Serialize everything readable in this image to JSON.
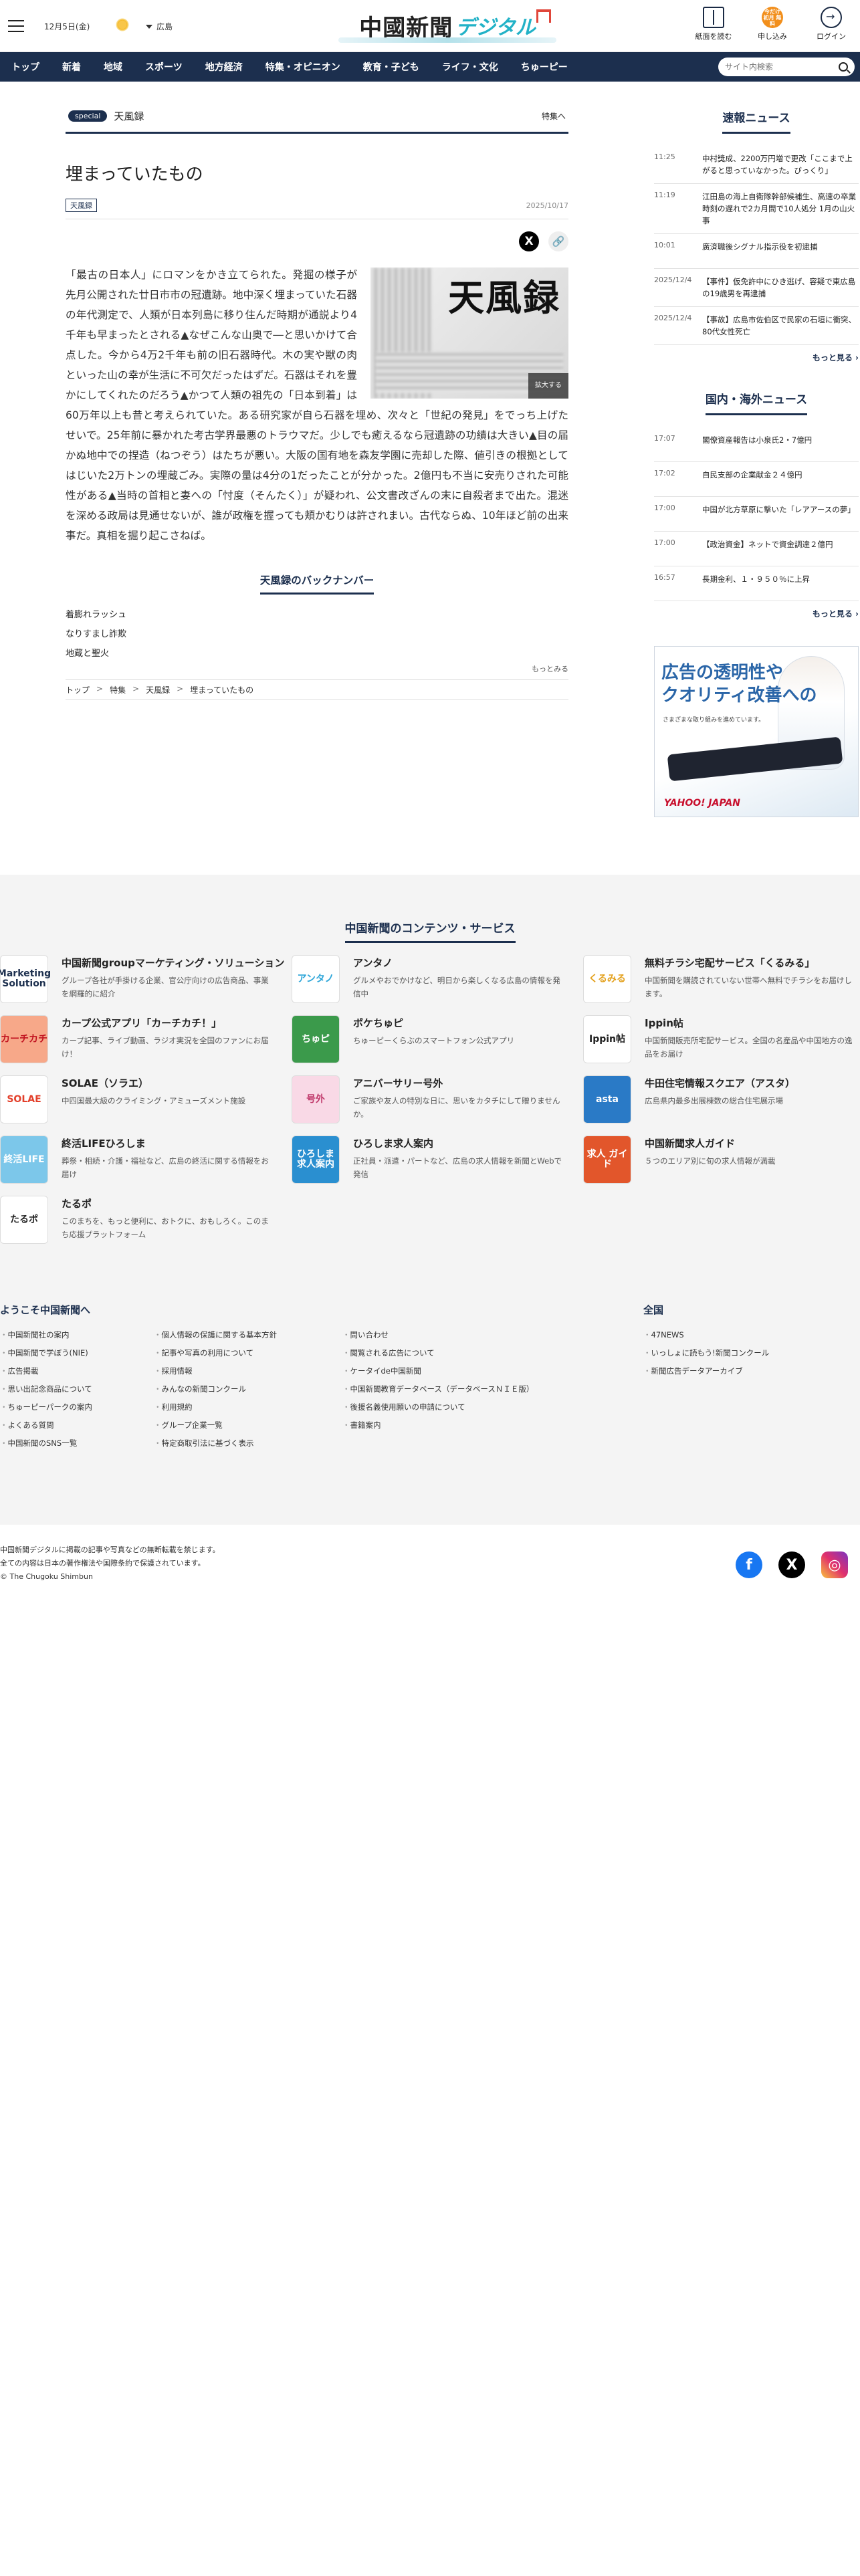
{
  "header": {
    "date": "12月5日(金)",
    "region": "広島",
    "logo_main": "中國新聞",
    "logo_sub": "デジタル",
    "icons": [
      {
        "name": "paper-icon",
        "label": "紙面を読む"
      },
      {
        "name": "apply-icon",
        "label": "申し込み",
        "badge": "今だけ 初月 無料"
      },
      {
        "name": "login-icon",
        "label": "ログイン"
      }
    ]
  },
  "nav": {
    "items": [
      "トップ",
      "新着",
      "地域",
      "スポーツ",
      "地方経済",
      "特集・オピニオン",
      "教育・子ども",
      "ライフ・文化",
      "ちゅーピー"
    ],
    "search_placeholder": "サイト内検索"
  },
  "special": {
    "pill": "special",
    "name": "天風録",
    "link": "特集へ"
  },
  "article": {
    "title": "埋まっていたもの",
    "tag": "天風録",
    "date": "2025/10/17",
    "photo_text": "天風録",
    "enlarge": "拡大する",
    "body": "「最古の日本人」にロマンをかき立てられた。発掘の様子が先月公開された廿日市市の冠遺跡。地中深く埋まっていた石器の年代測定で、人類が日本列島に移り住んだ時期が通説より4千年も早まったとされる▲なぜこんな山奥で―と思いかけて合点した。今から4万2千年も前の旧石器時代。木の実や獣の肉といった山の幸が生活に不可欠だったはずだ。石器はそれを豊かにしてくれたのだろう▲かつて人類の祖先の「日本到着」は60万年以上も昔と考えられていた。ある研究家が自ら石器を埋め、次々と「世紀の発見」をでっち上げたせいで。25年前に暴かれた考古学界最悪のトラウマだ。少しでも癒えるなら冠遺跡の功績は大きい▲目の届かぬ地中での捏造（ねつぞう）はたちが悪い。大阪の国有地を森友学園に売却した際、値引きの根拠としてはじいた2万トンの埋蔵ごみ。実際の量は4分の1だったことが分かった。2億円も不当に安売りされた可能性がある▲当時の首相と妻への「忖度（そんたく）」が疑われ、公文書改ざんの末に自殺者まで出た。混迷を深める政局は見通せないが、誰が政権を握っても頬かむりは許されまい。古代ならぬ、10年ほど前の出来事だ。真相を掘り起こさねば。"
  },
  "backnumbers": {
    "title": "天風録のバックナンバー",
    "items": [
      "着膨れラッシュ",
      "なりすまし詐欺",
      "地蔵と聖火"
    ],
    "more": "もっとみる"
  },
  "breadcrumb": [
    "トップ",
    "特集",
    "天風録",
    "埋まっていたもの"
  ],
  "sidebar": {
    "breaking": {
      "title": "速報ニュース",
      "items": [
        {
          "time": "11:25",
          "headline": "中村獎成、2200万円増で更改「ここまで上がると思っていなかった。びっくり」"
        },
        {
          "time": "11:19",
          "headline": "江田島の海上自衛隊幹部候補生、高速の卒業時刻の遅れで2カ月間で10人処分 1月の山火事"
        },
        {
          "time": "10:01",
          "headline": "廣済職後シグナル指示役を初逮捕"
        },
        {
          "time": "2025/12/4",
          "headline": "【事件】仮免許中にひき逃げ、容疑で東広島の19歳男を再逮捕"
        },
        {
          "time": "2025/12/4",
          "headline": "【事故】広島市佐伯区で民家の石垣に衝突、80代女性死亡"
        }
      ],
      "more": "もっと見る"
    },
    "national": {
      "title": "国内・海外ニュース",
      "items": [
        {
          "time": "17:07",
          "headline": "閣僚資産報告は小泉氏2・7億円"
        },
        {
          "time": "17:02",
          "headline": "自民支部の企業献金２４億円"
        },
        {
          "time": "17:00",
          "headline": "中国が北方草原に撃いた「レアアースの夢」"
        },
        {
          "time": "17:00",
          "headline": "【政治資金】ネットで資金調達２億円"
        },
        {
          "time": "16:57",
          "headline": "長期金利、１・９５０％に上昇"
        }
      ],
      "more": "もっと見る"
    },
    "ad": {
      "line1": "広告の透明性や",
      "line2": "クオリティ改善への",
      "sub": "さまざまな取り組みを進めています。",
      "logo": "YAHOO! JAPAN"
    }
  },
  "footer": {
    "services_title": "中国新聞のコンテンツ・サービス",
    "services": [
      {
        "name": "中国新聞groupマーケティング・ソリューション",
        "desc": "グループ各社が手掛ける企業、官公庁向けの広告商品、事業を網羅的に紹介",
        "logo": "Marketing Solution",
        "color": "#ffffff",
        "fg": "#1c2f4e"
      },
      {
        "name": "アンタノ",
        "desc": "グルメやおでかけなど、明日から楽しくなる広島の情報を発信中",
        "logo": "アンタノ",
        "color": "#ffffff",
        "fg": "#2aa4d8"
      },
      {
        "name": "無料チラシ宅配サービス「くるみる」",
        "desc": "中国新聞を購読されていない世帯へ無料でチラシをお届けします。",
        "logo": "くるみる",
        "color": "#ffffff",
        "fg": "#e3a01b"
      },
      {
        "name": "カープ公式アプリ「カーチカチ！」",
        "desc": "カープ記事、ライブ動画、ラジオ実況を全国のファンにお届け！",
        "logo": "カーチカチ",
        "color": "#f7a889",
        "fg": "#c1121f"
      },
      {
        "name": "ポケちゅピ",
        "desc": "ちゅーピーくらぶのスマートフォン公式アプリ",
        "logo": "ちゅピ",
        "color": "#3b9a4b",
        "fg": "#ffffff"
      },
      {
        "name": "Ippin帖",
        "desc": "中国新聞販売所宅配サービス。全国の名産品や中国地方の逸品をお届け",
        "logo": "Ippin帖",
        "color": "#ffffff",
        "fg": "#222222"
      },
      {
        "name": "SOLAE（ソラエ）",
        "desc": "中四国最大級のクライミング・アミューズメント施設",
        "logo": "SOLAE",
        "color": "#ffffff",
        "fg": "#e3402b"
      },
      {
        "name": "アニバーサリー号外",
        "desc": "ご家族や友人の特別な日に、思いをカタチにして贈りませんか。",
        "logo": "号外",
        "color": "#f9d9e6",
        "fg": "#c0396b"
      },
      {
        "name": "牛田住宅情報スクエア（アスタ）",
        "desc": "広島県内最多出展棟数の総合住宅展示場",
        "logo": "asta",
        "color": "#2a7ac6",
        "fg": "#ffffff"
      },
      {
        "name": "終活LIFEひろしま",
        "desc": "葬祭・相続・介護・福祉など、広島の終活に関する情報をお届け",
        "logo": "終活LIFE",
        "color": "#7cc7ea",
        "fg": "#ffffff"
      },
      {
        "name": "ひろしま求人案内",
        "desc": "正社員・派遣・パートなど、広島の求人情報を新聞とWebで発信",
        "logo": "ひろしま 求人案内",
        "color": "#2a8fd0",
        "fg": "#ffffff"
      },
      {
        "name": "中国新聞求人ガイド",
        "desc": "５つのエリア別に旬の求人情報が満載",
        "logo": "求人 ガイド",
        "color": "#e2562b",
        "fg": "#ffffff"
      },
      {
        "name": "たるポ",
        "desc": "このまちを、もっと便利に、おトクに、おもしろく。このまち応援プラットフォーム",
        "logo": "たるポ",
        "color": "#ffffff",
        "fg": "#222222"
      }
    ],
    "links_title": "ようこそ中国新聞へ",
    "link_cols": [
      [
        "中国新聞社の案内",
        "中国新聞で学ぼう(NIE)",
        "広告掲載",
        "思い出記念商品について",
        "ちゅーピーパークの案内",
        "よくある質問",
        "中国新聞のSNS一覧"
      ],
      [
        "個人情報の保護に関する基本方針",
        "記事や写真の利用について",
        "採用情報",
        "みんなの新聞コンクール",
        "利用規約",
        "グループ企業一覧",
        "特定商取引法に基づく表示"
      ],
      [
        "問い合わせ",
        "閲覧される広告について",
        "ケータイde中国新聞",
        "中国新聞教育データベース（データベースＮＩＥ版）",
        "後援名義使用願いの申請について",
        "書籍案内"
      ]
    ],
    "zenkoku_title": "全国",
    "zenkoku": [
      "47NEWS",
      "いっしょに読もう!新聞コンクール",
      "新聞広告データアーカイブ"
    ],
    "copy": [
      "中国新聞デジタルに掲載の記事や写真などの無断転載を禁じます。",
      "全ての内容は日本の著作権法や国際条約で保護されています。",
      "© The Chugoku Shimbun"
    ],
    "social": [
      "f",
      "X",
      "◎"
    ]
  },
  "colors": {
    "navy": "#1c2f4e",
    "accent": "#22b2c7",
    "orange": "#f28f1c"
  }
}
